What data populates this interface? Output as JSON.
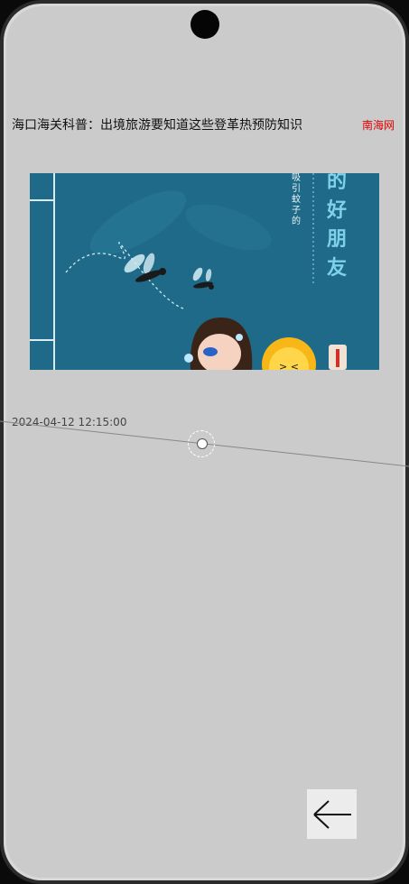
{
  "article": {
    "headline": "海口海关科普：出境旅游要知道这些登革热预防知识",
    "source": "南海网",
    "timestamp": "2024-04-12 12:15:00"
  },
  "image": {
    "vertical_title": "的好朋友",
    "vertical_small": "吸引蚊子的"
  },
  "icons": {
    "back": "arrow-left-icon"
  },
  "colors": {
    "source": "#e00000",
    "image_bg": "#1f6a88",
    "title_accent": "#7fd1ea"
  }
}
